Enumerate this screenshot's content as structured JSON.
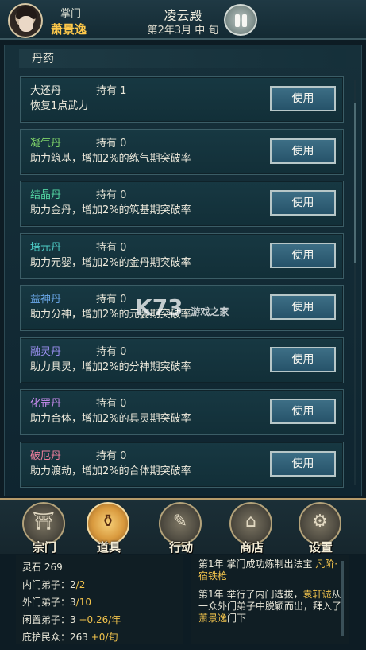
{
  "header": {
    "leader_label": "掌门",
    "leader_name": "萧景逸",
    "sect_name": "凌云殿",
    "date": "第2年3月 中 旬"
  },
  "section": {
    "title": "丹药"
  },
  "use_label": "使用",
  "items": [
    {
      "name": "大还丹",
      "holding": "持有 1",
      "desc": "恢复1点武力",
      "color": "#f2f0e4"
    },
    {
      "name": "凝气丹",
      "holding": "持有 0",
      "desc": "助力筑基，增加2%的练气期突破率",
      "color": "#7fd36a"
    },
    {
      "name": "结晶丹",
      "holding": "持有 0",
      "desc": "助力金丹，增加2%的筑基期突破率",
      "color": "#54d7a3"
    },
    {
      "name": "培元丹",
      "holding": "持有 0",
      "desc": "助力元婴，增加2%的金丹期突破率",
      "color": "#4fd0c9"
    },
    {
      "name": "益神丹",
      "holding": "持有 0",
      "desc": "助力分神，增加2%的元婴期突破率",
      "color": "#6aa7e8"
    },
    {
      "name": "融灵丹",
      "holding": "持有 0",
      "desc": "助力具灵，增加2%的分神期突破率",
      "color": "#9a8ff0"
    },
    {
      "name": "化罡丹",
      "holding": "持有 0",
      "desc": "助力合体，增加2%的具灵期突破率",
      "color": "#c98cf0"
    },
    {
      "name": "破厄丹",
      "holding": "持有 0",
      "desc": "助力渡劫，增加2%的合体期突破率",
      "color": "#f07f9e"
    }
  ],
  "nav": [
    {
      "label": "宗门",
      "icon": "temple-icon",
      "glyph": "⛩"
    },
    {
      "label": "道具",
      "icon": "pouch-icon",
      "glyph": "⚱"
    },
    {
      "label": "行动",
      "icon": "scroll-icon",
      "glyph": "✎"
    },
    {
      "label": "商店",
      "icon": "shop-icon",
      "glyph": "⌂"
    },
    {
      "label": "设置",
      "icon": "gear-icon",
      "glyph": "⚙"
    }
  ],
  "status": {
    "spirit_stone_label": "灵石",
    "spirit_stone_value": "269",
    "inner_label": "内门弟子：",
    "inner_value": "2",
    "inner_max": "/2",
    "outer_label": "外门弟子：",
    "outer_value": "3",
    "outer_max": "/10",
    "idle_label": "闲置弟子：",
    "idle_value": "3",
    "idle_rate": "+0.26/年",
    "protect_label": "庇护民众：",
    "protect_value": "263",
    "protect_rate": "+0/旬"
  },
  "log": {
    "entry1_prefix": "第1年 掌门成功炼制出法宝",
    "entry1_item": "凡阶·宿铁枪",
    "entry2_prefix": "第1年 举行了内门选拔，",
    "entry2_person": "袁轩诚",
    "entry2_mid": "从一众外门弟子中脱颖而出，拜入了",
    "entry2_master": "萧景逸",
    "entry2_suffix": "门下"
  },
  "watermark": {
    "main": "K73",
    "sub": "游戏之家"
  }
}
